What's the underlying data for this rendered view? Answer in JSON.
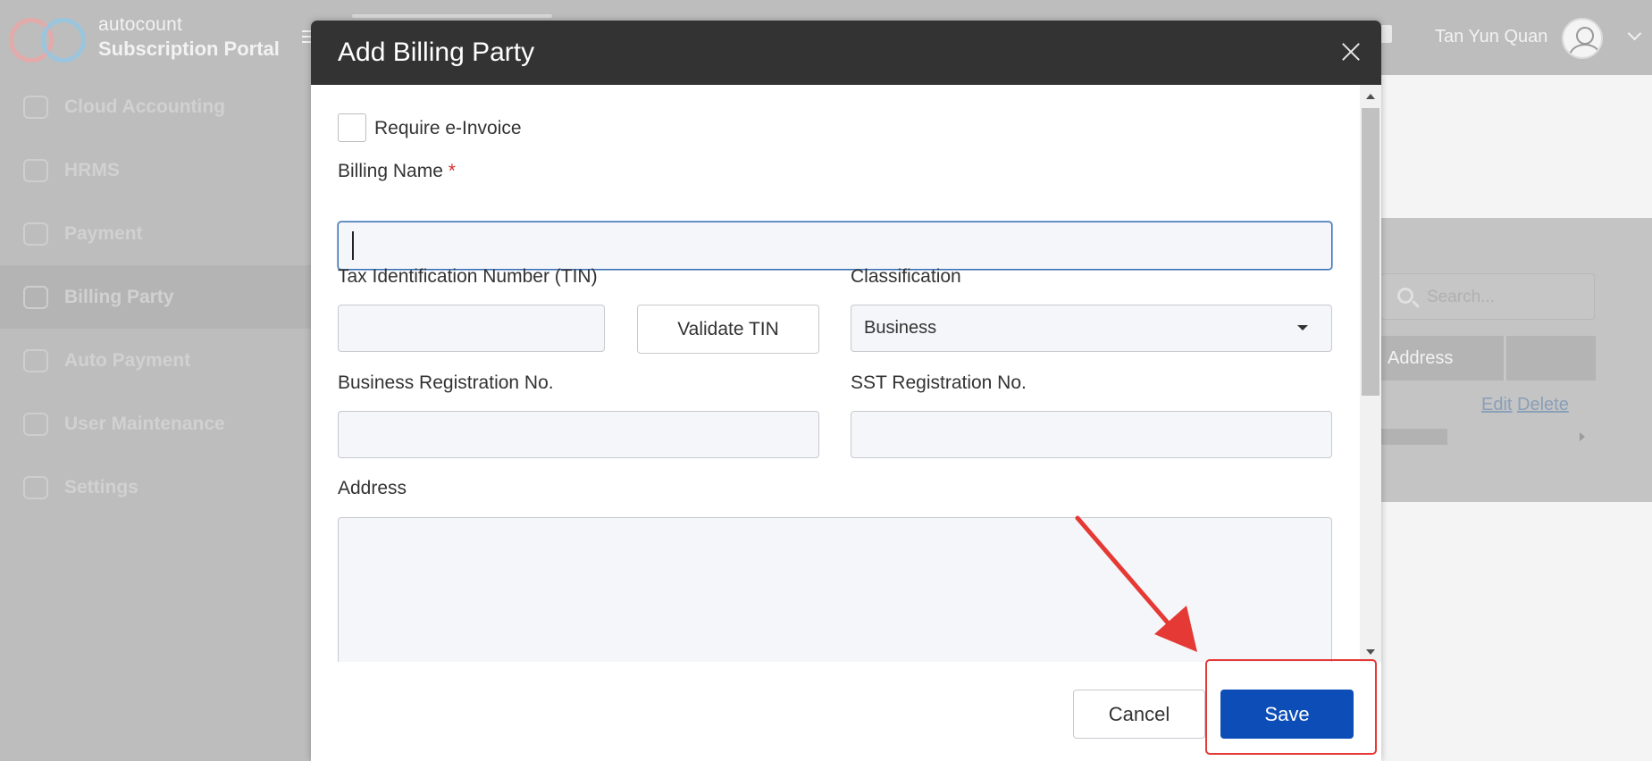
{
  "app": {
    "brand_top": "autocount",
    "brand_bottom": "Subscription Portal",
    "user_name": "Tan Yun Quan"
  },
  "sidebar": {
    "items": [
      {
        "label": "Cloud Accounting",
        "icon": "cloud-icon"
      },
      {
        "label": "HRMS",
        "icon": "cloud-people-icon"
      },
      {
        "label": "Payment",
        "icon": "payment-icon"
      },
      {
        "label": "Billing Party",
        "icon": "billing-icon",
        "active": true
      },
      {
        "label": "Auto Payment",
        "icon": "auto-payment-icon"
      },
      {
        "label": "User Maintenance",
        "icon": "user-icon"
      },
      {
        "label": "Settings",
        "icon": "gear-icon"
      }
    ]
  },
  "background": {
    "search_placeholder": "Search...",
    "table_header_address": "Address",
    "link_edit": "Edit",
    "link_delete": "Delete"
  },
  "modal": {
    "title": "Add Billing Party",
    "require_einvoice_label": "Require e-Invoice",
    "require_einvoice_checked": false,
    "billing_name_label": "Billing Name",
    "required_mark": "*",
    "billing_name_value": "",
    "tin_label": "Tax Identification Number (TIN)",
    "tin_value": "",
    "validate_tin_label": "Validate TIN",
    "classification_label": "Classification",
    "classification_value": "Business",
    "brn_label": "Business Registration No.",
    "brn_value": "",
    "sst_label": "SST Registration No.",
    "sst_value": "",
    "address_label": "Address",
    "address_value": "",
    "cancel_label": "Cancel",
    "save_label": "Save"
  },
  "colors": {
    "header_bg": "#333333",
    "save_bg": "#0c4db8",
    "annotation": "#e53935"
  }
}
